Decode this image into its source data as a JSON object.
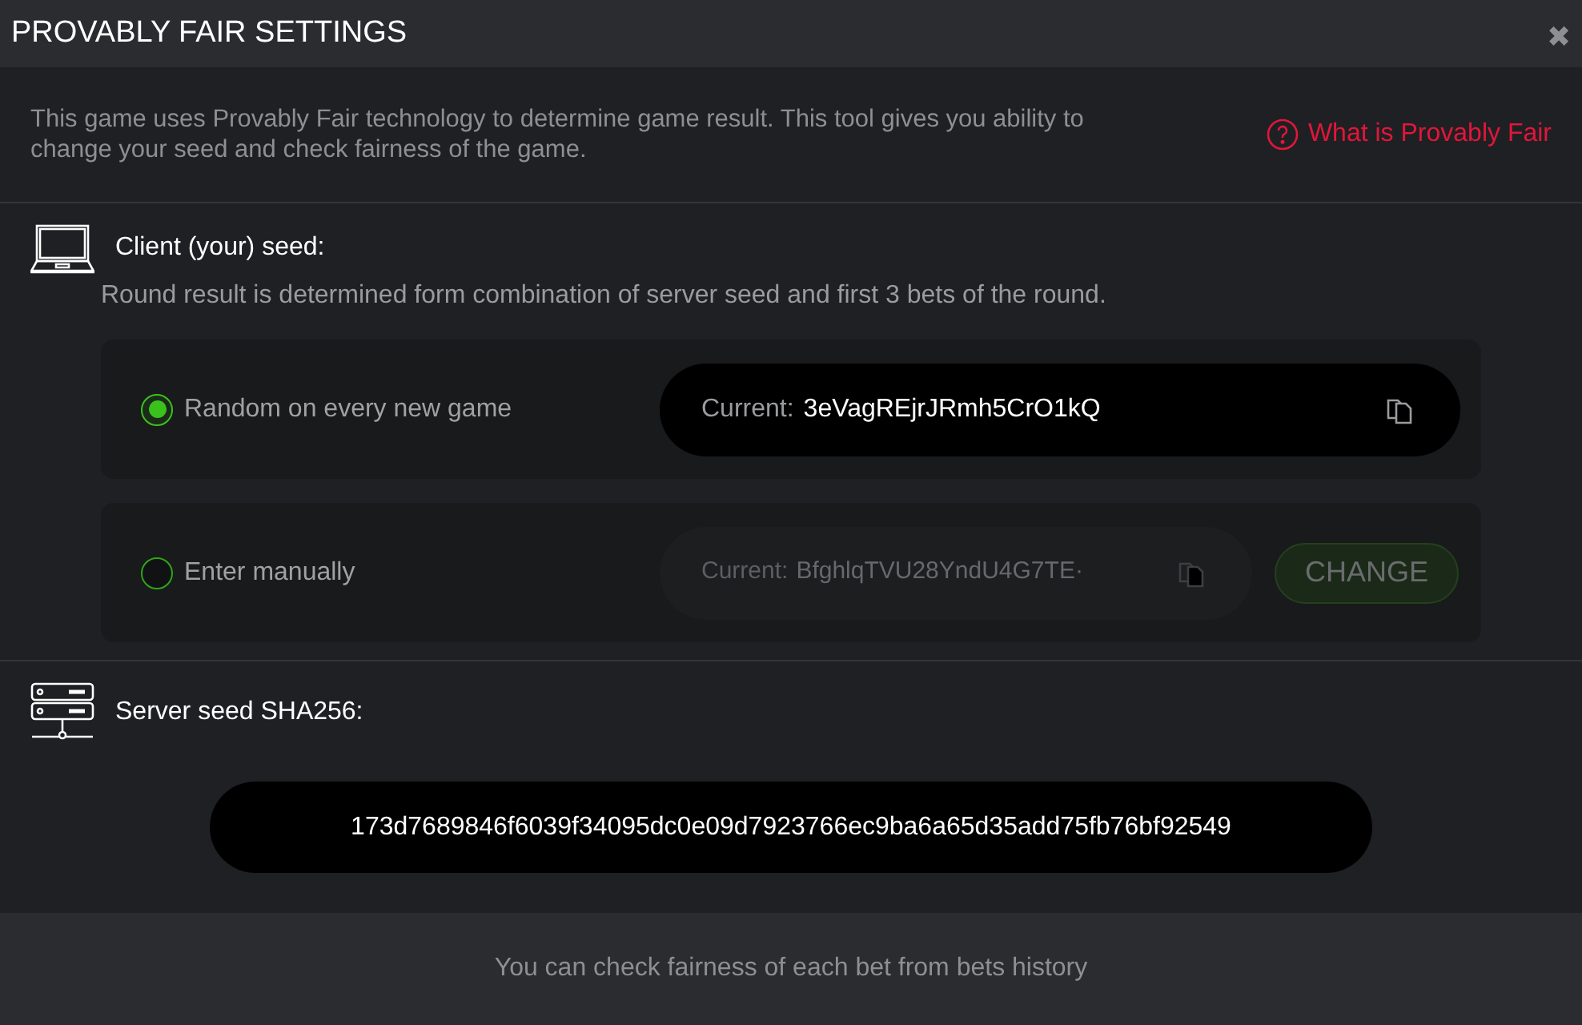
{
  "window": {
    "title": "PROVABLY FAIR SETTINGS",
    "close": "✖"
  },
  "intro": {
    "text": "This game uses Provably Fair technology to determine game result. This tool gives you ability to change your seed and check fairness of the game.",
    "link": "What is Provably Fair"
  },
  "client_seed": {
    "title": "Client (your) seed:",
    "description": "Round result is determined form combination of server seed and first 3 bets of the round.",
    "options": [
      {
        "kind": "current",
        "label": "Random on every new game",
        "selected": true,
        "field_label": "Current:",
        "value": "3eVagREjrJRmh5CrO1kQ"
      },
      {
        "kind": "manual",
        "label": "Enter manually",
        "selected": false,
        "field_label": "Current:",
        "value": "BfghlqTVU28YndU4G7TE·",
        "button": "CHANGE",
        "disabled": true
      }
    ]
  },
  "server_seed": {
    "title": "Server seed SHA256:",
    "value": "173d7689846f6039f34095dc0e09d7923766ec9ba6a65d35add75fb76bf92549"
  },
  "footer": {
    "text": "You can check fairness of each bet from bets history"
  }
}
